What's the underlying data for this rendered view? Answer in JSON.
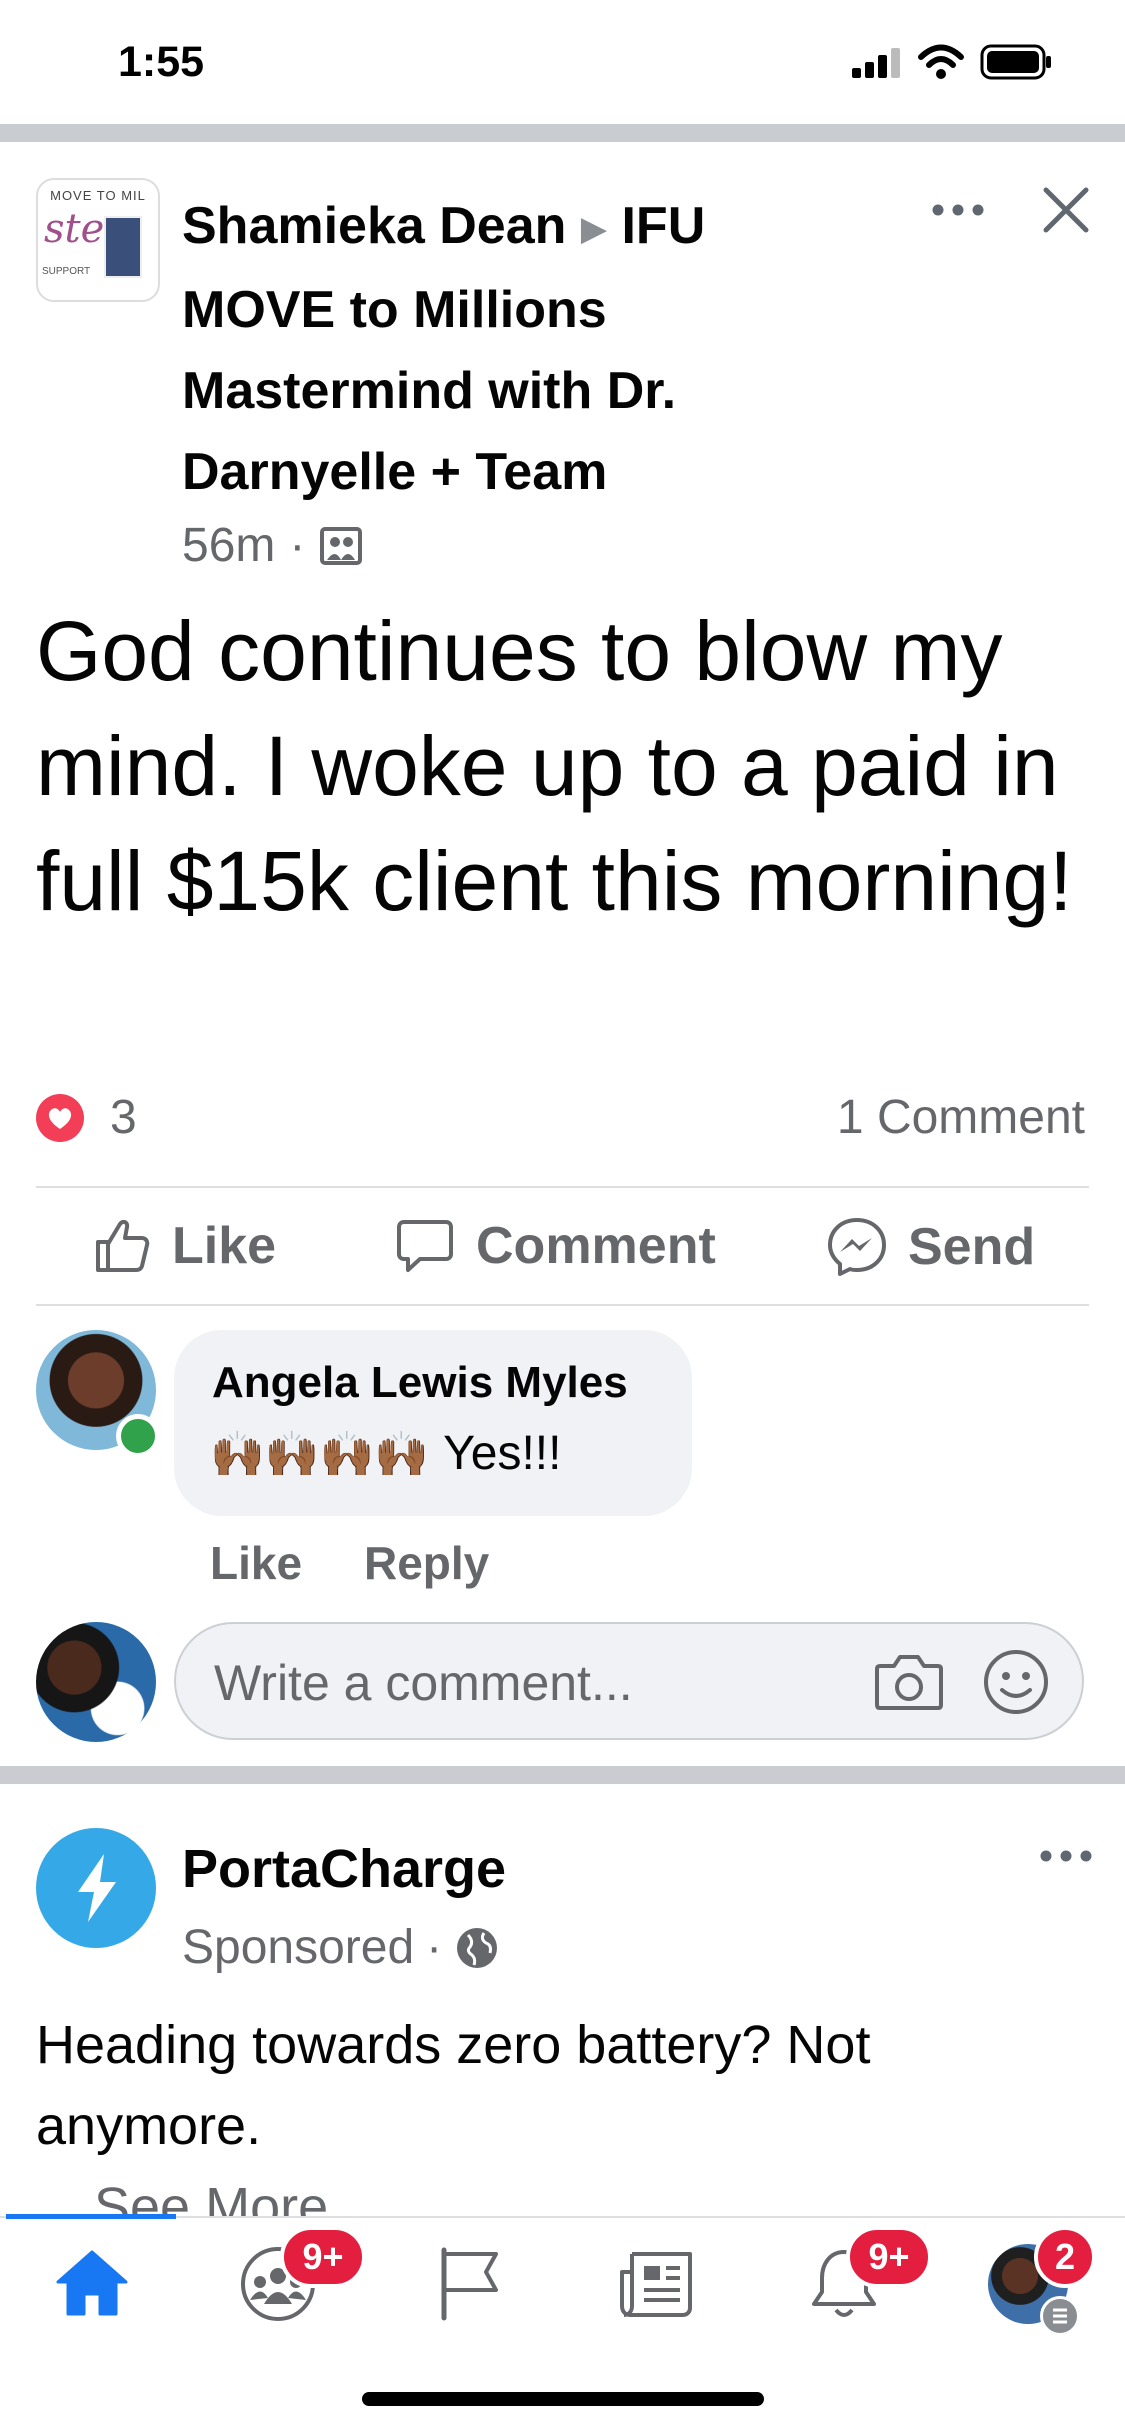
{
  "status_bar": {
    "time": "1:55"
  },
  "post": {
    "author": "Shamieka Dean",
    "group": "IFU MOVE to Millions Mastermind with Dr. Darnyelle + Team",
    "group_avatar_text_top": "MOVE TO MIL",
    "group_avatar_text_bottom": "SUPPORT",
    "time": "56m",
    "separator": "·",
    "body": "God continues to blow my mind. I woke up to a paid in full $15k client this morning!",
    "reactions_count": "3",
    "comments_count": "1 Comment",
    "actions": {
      "like": "Like",
      "comment": "Comment",
      "send": "Send"
    }
  },
  "comment": {
    "author": "Angela Lewis Myles",
    "emojis": "🙌🏾🙌🏾🙌🏾🙌🏾",
    "text": "Yes!!!",
    "like": "Like",
    "reply": "Reply"
  },
  "composer": {
    "placeholder": "Write a comment..."
  },
  "ad": {
    "name": "PortaCharge",
    "sponsored": "Sponsored",
    "separator": "·",
    "text": "Heading towards zero battery? Not anymore.",
    "see_more": "See More"
  },
  "tabbar": {
    "groups_badge": "9+",
    "notifications_badge": "9+",
    "menu_badge": "2"
  },
  "colors": {
    "accent": "#1877f2",
    "badge": "#e41e3f",
    "text_secondary": "#65676b",
    "online": "#31a24c"
  }
}
